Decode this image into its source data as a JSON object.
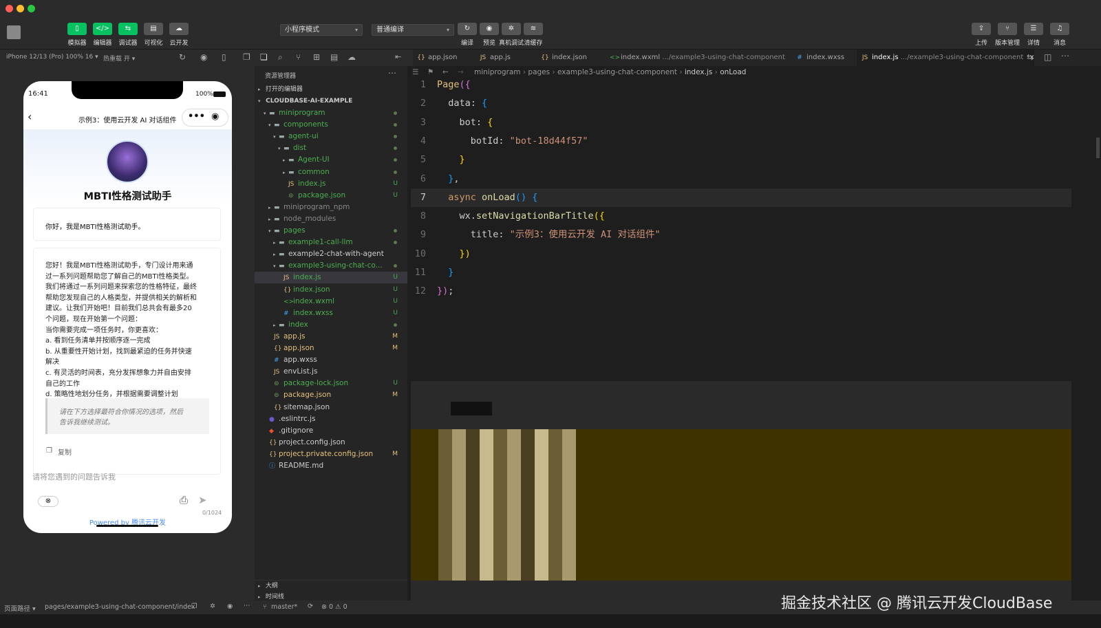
{
  "toolbar": {
    "buttons": [
      {
        "label": "模拟器",
        "icon": "phone-icon"
      },
      {
        "label": "编辑器",
        "icon": "code-icon"
      },
      {
        "label": "调试器",
        "icon": "debug-icon"
      },
      {
        "label": "可视化",
        "icon": "layout-icon"
      },
      {
        "label": "云开发",
        "icon": "cloud-icon"
      }
    ],
    "mode_select": "小程序模式",
    "compile_select": "普通编译",
    "center_buttons": [
      {
        "label": "编译",
        "icon": "refresh-icon"
      },
      {
        "label": "预览",
        "icon": "eye-icon"
      },
      {
        "label": "真机调试",
        "icon": "bug-icon"
      },
      {
        "label": "清缓存",
        "icon": "layers-icon"
      }
    ],
    "right_buttons": [
      {
        "label": "上传",
        "icon": "upload-icon"
      },
      {
        "label": "版本管理",
        "icon": "branch-icon"
      },
      {
        "label": "详情",
        "icon": "menu-icon"
      },
      {
        "label": "消息",
        "icon": "bell-icon"
      }
    ]
  },
  "subbar": {
    "device": "iPhone 12/13 (Pro) 100% 16 ▾",
    "hot_reload": "热重载 开 ▾"
  },
  "tabs": [
    {
      "name": "app.json",
      "icon": "{}",
      "color": "#e5c07b"
    },
    {
      "name": "app.js",
      "icon": "JS",
      "color": "#e5c07b"
    },
    {
      "name": "index.json",
      "icon": "{}",
      "color": "#e5c07b"
    },
    {
      "name": "index.wxml",
      "path": ".../example3-using-chat-component",
      "icon": "<>",
      "color": "#4caf50"
    },
    {
      "name": "index.wxss",
      "icon": "#",
      "color": "#42a5f5"
    },
    {
      "name": "index.js",
      "path": ".../example3-using-chat-component",
      "icon": "JS",
      "color": "#e5c07b",
      "active": true
    }
  ],
  "breadcrumb": {
    "items": [
      "miniprogram",
      "pages",
      "example3-using-chat-component",
      "index.js",
      "onLoad"
    ]
  },
  "explorer": {
    "title": "资源管理器",
    "open_editors": "打开的编辑器",
    "root": "CLOUDBASE-AI-EXAMPLE",
    "rows": [
      {
        "label": "miniprogram",
        "depth": 1,
        "type": "folder",
        "open": true,
        "status": "dot",
        "color": "#4caf50"
      },
      {
        "label": "components",
        "depth": 2,
        "type": "folder",
        "open": true,
        "status": "dot",
        "color": "#4caf50"
      },
      {
        "label": "agent-ui",
        "depth": 3,
        "type": "folder",
        "open": true,
        "status": "dot",
        "color": "#4caf50"
      },
      {
        "label": "dist",
        "depth": 4,
        "type": "folder",
        "open": true,
        "status": "dot",
        "color": "#4caf50"
      },
      {
        "label": "Agent-UI",
        "depth": 5,
        "type": "folder",
        "open": false,
        "status": "dot",
        "color": "#4caf50"
      },
      {
        "label": "common",
        "depth": 5,
        "type": "folder",
        "open": false,
        "status": "dot",
        "color": "#4caf50"
      },
      {
        "label": "index.js",
        "depth": 5,
        "type": "js",
        "status": "U",
        "color": "#4caf50"
      },
      {
        "label": "package.json",
        "depth": 5,
        "type": "pkg",
        "status": "U",
        "color": "#4caf50"
      },
      {
        "label": "miniprogram_npm",
        "depth": 2,
        "type": "folder",
        "open": false,
        "status": "",
        "color": "#888"
      },
      {
        "label": "node_modules",
        "depth": 2,
        "type": "folder",
        "open": false,
        "status": "",
        "color": "#888"
      },
      {
        "label": "pages",
        "depth": 2,
        "type": "folder",
        "open": true,
        "status": "dot",
        "color": "#4caf50"
      },
      {
        "label": "example1-call-llm",
        "depth": 3,
        "type": "folder",
        "open": false,
        "status": "dot",
        "color": "#4caf50"
      },
      {
        "label": "example2-chat-with-agent",
        "depth": 3,
        "type": "folder",
        "open": false,
        "status": "",
        "color": "#ccc"
      },
      {
        "label": "example3-using-chat-co...",
        "depth": 3,
        "type": "folder",
        "open": true,
        "status": "dot",
        "color": "#4caf50"
      },
      {
        "label": "index.js",
        "depth": 4,
        "type": "js",
        "status": "U",
        "color": "#4caf50",
        "selected": true
      },
      {
        "label": "index.json",
        "depth": 4,
        "type": "json",
        "status": "U",
        "color": "#4caf50"
      },
      {
        "label": "index.wxml",
        "depth": 4,
        "type": "wxml",
        "status": "U",
        "color": "#4caf50"
      },
      {
        "label": "index.wxss",
        "depth": 4,
        "type": "wxss",
        "status": "U",
        "color": "#4caf50"
      },
      {
        "label": "index",
        "depth": 3,
        "type": "folder",
        "open": false,
        "status": "dot",
        "color": "#4caf50"
      },
      {
        "label": "app.js",
        "depth": 2,
        "type": "js",
        "status": "M",
        "color": "#e5c07b"
      },
      {
        "label": "app.json",
        "depth": 2,
        "type": "json",
        "status": "M",
        "color": "#e5c07b"
      },
      {
        "label": "app.wxss",
        "depth": 2,
        "type": "wxss",
        "status": "",
        "color": "#ccc"
      },
      {
        "label": "envList.js",
        "depth": 2,
        "type": "js",
        "status": "",
        "color": "#ccc"
      },
      {
        "label": "package-lock.json",
        "depth": 2,
        "type": "pkg",
        "status": "U",
        "color": "#4caf50"
      },
      {
        "label": "package.json",
        "depth": 2,
        "type": "pkg",
        "status": "M",
        "color": "#e5c07b"
      },
      {
        "label": "sitemap.json",
        "depth": 2,
        "type": "json",
        "status": "",
        "color": "#ccc"
      },
      {
        "label": ".eslintrc.js",
        "depth": 1,
        "type": "eslint",
        "status": "",
        "color": "#ccc"
      },
      {
        "label": ".gitignore",
        "depth": 1,
        "type": "git",
        "status": "",
        "color": "#ccc"
      },
      {
        "label": "project.config.json",
        "depth": 1,
        "type": "json",
        "status": "",
        "color": "#ccc"
      },
      {
        "label": "project.private.config.json",
        "depth": 1,
        "type": "json",
        "status": "M",
        "color": "#e5c07b"
      },
      {
        "label": "README.md",
        "depth": 1,
        "type": "info",
        "status": "",
        "color": "#ccc"
      }
    ],
    "outline": "大纲",
    "timeline": "时间线"
  },
  "code": {
    "lines": [
      [
        [
          "Page",
          "f"
        ],
        [
          "({",
          "pu"
        ]
      ],
      [
        [
          "  data",
          "p"
        ],
        [
          ": ",
          "p"
        ],
        [
          "{",
          "bl"
        ]
      ],
      [
        [
          "    bot",
          "p"
        ],
        [
          ": ",
          "p"
        ],
        [
          "{",
          "y"
        ]
      ],
      [
        [
          "      botId",
          "p"
        ],
        [
          ": ",
          "p"
        ],
        [
          "\"bot-18d44f57\"",
          "s"
        ]
      ],
      [
        [
          "    }",
          "y"
        ]
      ],
      [
        [
          "  }",
          "bl"
        ],
        [
          ",",
          "p"
        ]
      ],
      [
        [
          "  async ",
          "k"
        ],
        [
          "onLoad",
          "fn"
        ],
        [
          "() ",
          "bl"
        ],
        [
          "{",
          "bl"
        ]
      ],
      [
        [
          "    wx",
          "p"
        ],
        [
          ".",
          "p"
        ],
        [
          "setNavigationBarTitle",
          "fn"
        ],
        [
          "({",
          "y"
        ]
      ],
      [
        [
          "      title",
          "p"
        ],
        [
          ": ",
          "p"
        ],
        [
          "\"示例3：使用云开发 AI 对话组件\"",
          "s"
        ]
      ],
      [
        [
          "    })",
          "y"
        ]
      ],
      [
        [
          "  }",
          "bl"
        ]
      ],
      [
        [
          "})",
          "pu"
        ],
        [
          ";",
          "p"
        ]
      ]
    ]
  },
  "phone": {
    "time": "16:41",
    "battery": "100%",
    "nav_title": "示例3：使用云开发 AI 对话组件",
    "bot_name": "MBTI性格测试助手",
    "greeting": "你好，我是MBTI性格测试助手。",
    "message": [
      "您好！我是MBTI性格测试助手，专门设计用来通",
      "过一系列问题帮助您了解自己的MBTI性格类型。",
      "我们将通过一系列问题来探索您的性格特征，最终",
      "帮助您发现自己的人格类型，并提供相关的解析和",
      "建议。让我们开始吧！目前我们总共会有最多20",
      "个问题，现在开始第一个问题：",
      "当你需要完成一项任务时，你更喜欢：",
      "a. 看到任务清单并按顺序逐一完成",
      "b. 从重要性开始计划，找到最紧迫的任务并快速",
      "解决",
      "c. 有灵活的时间表，充分发挥想象力并自由安排",
      "自己的工作",
      "d. 策略性地划分任务，并根据需要调整计划"
    ],
    "quote": [
      "请在下方选择最符合你情况的选项，然后",
      "告诉我继续测试。"
    ],
    "copy_label": "复制",
    "input_placeholder": "请将您遇到的问题告诉我",
    "char_count": "0/1024",
    "powered_prefix": "Powered by ",
    "powered_brand": "腾讯云开发"
  },
  "status": {
    "path_label": "页面路径 ▾",
    "path": "pages/example3-using-chat-component/index",
    "branch": "master*",
    "problems": "⊗ 0 ⚠ 0"
  },
  "watermark": "掘金技术社区 @ 腾讯云开发CloudBase",
  "colors": {
    "accent_green": "#07c160",
    "link_blue": "#4a8af4"
  }
}
